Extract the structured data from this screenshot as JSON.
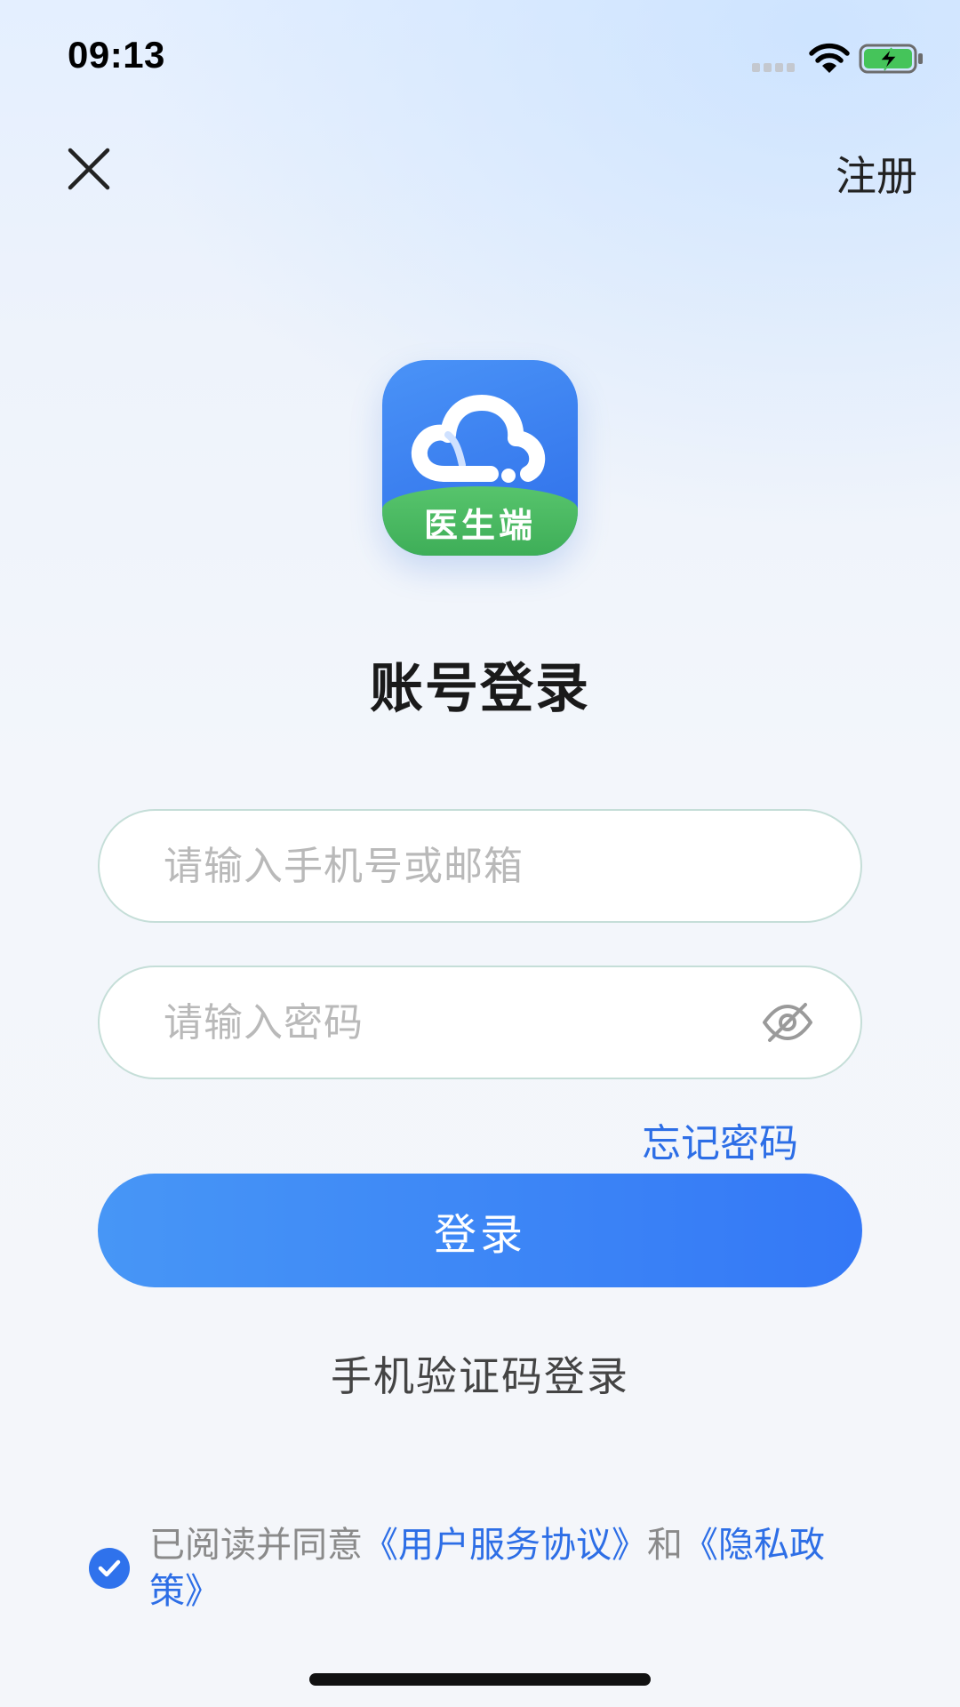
{
  "status_bar": {
    "time": "09:13"
  },
  "nav": {
    "close_icon": "close-icon",
    "register_label": "注册"
  },
  "logo": {
    "badge_text": "医生端"
  },
  "title": "账号登录",
  "form": {
    "phone_placeholder": "请输入手机号或邮箱",
    "phone_value": "",
    "password_placeholder": "请输入密码",
    "password_value": "",
    "password_visibility_icon": "eye-off-icon",
    "forgot_label": "忘记密码",
    "login_label": "登录",
    "sms_login_label": "手机验证码登录"
  },
  "agreement": {
    "checked": true,
    "prefix": "已阅读并同意",
    "terms_label": "《用户服务协议》",
    "conjunction": "和",
    "privacy_label": "《隐私政策》"
  },
  "colors": {
    "accent": "#3478f6",
    "link": "#2d6ee6",
    "logo_green": "#4cbb62"
  }
}
